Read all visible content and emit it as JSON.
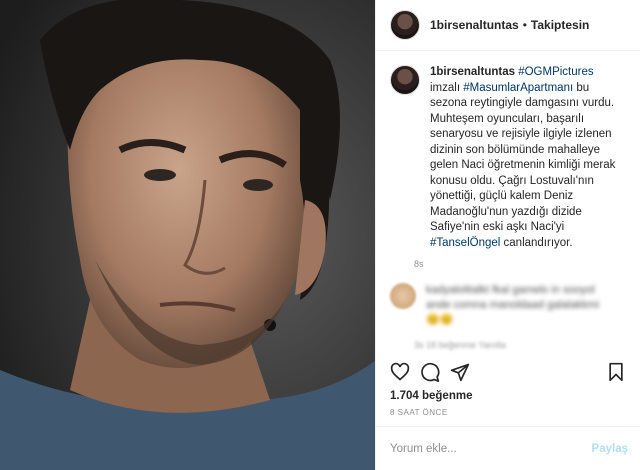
{
  "header": {
    "username": "1birsenaltuntas",
    "separator": "•",
    "follow_status": "Takiptesin"
  },
  "caption": {
    "username": "1birsenaltuntas",
    "tag1": "#OGMPictures",
    "text1": " imzalı ",
    "tag2": "#MasumlarApartmanı",
    "text2": " bu sezona reytingiyle damgasını vurdu. Muhteşem oyuncuları, başarılı senaryosu ve rejisiyle ilgiyle izlenen dizinin son bölümünde mahalleye gelen Naci öğretmenin kimliği merak konusu oldu. Çağrı Lostuvalı'nın yönettiği, güçlü kalem Deniz Madanoğlu'nun yazdığı dizide Safiye'nin eski aşkı Naci'yi ",
    "tag3": "#TanselÖngel",
    "text3": " canlandırıyor.",
    "time": "8s"
  },
  "comment": {
    "blurred_text": "kadyalolitalkt fkal gamelo in sooyol ande comna manoldaad galalakkmi 😊😊",
    "meta": "3s  18 beğenme  Yanıtla"
  },
  "actions": {
    "likes": "1.704 beğenme",
    "time_ago": "8 SAAT ÖNCE"
  },
  "comment_box": {
    "placeholder": "Yorum ekle...",
    "share_label": "Paylaş"
  },
  "colors": {
    "hashtag": "#00376b",
    "share_disabled": "#b2dffc",
    "muted": "#8e8e8e"
  }
}
